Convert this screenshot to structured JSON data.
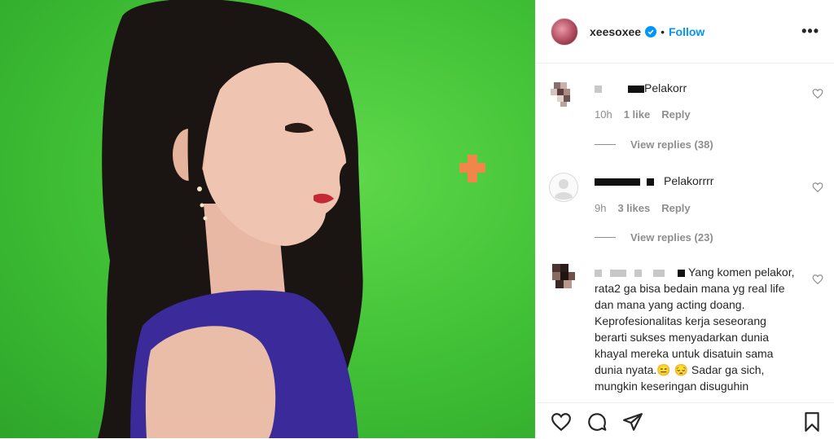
{
  "post": {
    "username": "xeesoxee",
    "follow_label": "Follow",
    "dot": "•",
    "more_label": "•••"
  },
  "comments": [
    {
      "text": "Pelakorr",
      "time": "10h",
      "likes": "1 like",
      "reply": "Reply",
      "view_replies": "View replies (38)"
    },
    {
      "text": "Pelakorrrr",
      "time": "9h",
      "likes": "3 likes",
      "reply": "Reply",
      "view_replies": "View replies (23)"
    },
    {
      "text_lines": [
        "Yang komen pelakor,",
        "rata2 ga bisa bedain mana yg real life",
        "dan mana yang acting doang.",
        "Keprofesionalitas kerja seseorang",
        "berarti sukses menyadarkan dunia",
        "khayal mereka untuk disatuin sama",
        "dunia nyata.😑 😔  Sadar ga sich,",
        "mungkin keseringan disuguhin"
      ]
    }
  ],
  "icons": {
    "verified": "verified-badge-icon",
    "like": "heart-icon",
    "comment": "comment-icon",
    "share": "paper-plane-icon",
    "save": "bookmark-icon"
  },
  "colors": {
    "accent": "#0095f6",
    "green_screen": "#3fbf35",
    "text": "#262626",
    "muted": "#8e8e8e"
  }
}
